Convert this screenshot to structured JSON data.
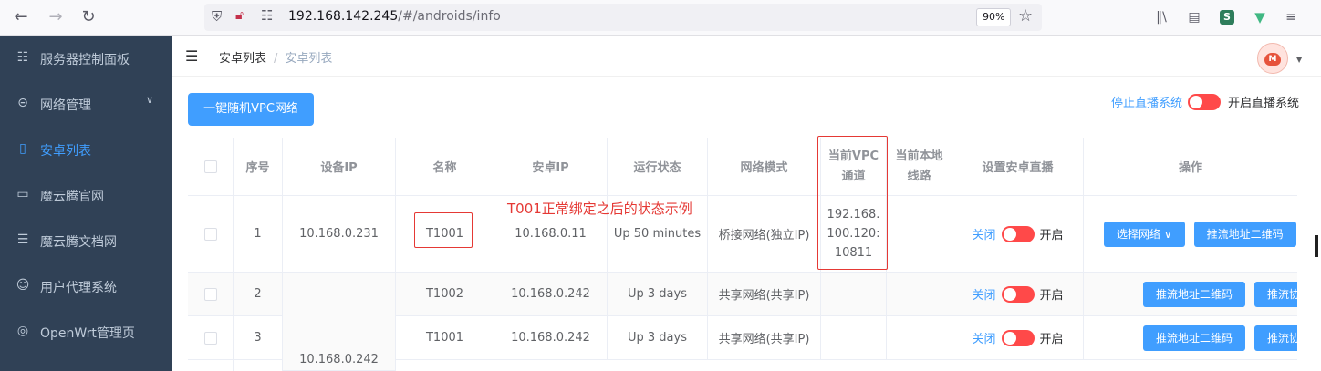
{
  "browser": {
    "url_host": "192.168.142.245",
    "url_path": "/#/androids/info",
    "zoom": "90%"
  },
  "sidebar": {
    "items": [
      {
        "label": "服务器控制面板",
        "icon": "sitemap-icon"
      },
      {
        "label": "网络管理",
        "icon": "network-icon"
      },
      {
        "label": "安卓列表",
        "icon": "phone-icon",
        "active": true
      },
      {
        "label": "魔云腾官网",
        "icon": "monitor-icon"
      },
      {
        "label": "魔云腾文档网",
        "icon": "document-icon"
      },
      {
        "label": "用户代理系统",
        "icon": "user-icon"
      },
      {
        "label": "OpenWrt管理页",
        "icon": "wifi-router-icon"
      }
    ]
  },
  "breadcrumb": {
    "first": "安卓列表",
    "sep": "/",
    "second": "安卓列表"
  },
  "toolbar": {
    "random_vpc_button": "一键随机VPC网络",
    "stop_live": "停止直播系统",
    "start_live": "开启直播系统"
  },
  "table": {
    "headers": [
      "序号",
      "设备IP",
      "名称",
      "安卓IP",
      "运行状态",
      "网络模式",
      "当前VPC\n通道",
      "当前本地\n线路",
      "设置安卓直播",
      "操作"
    ],
    "rows": [
      {
        "index": "1",
        "device_ip": "10.168.0.231",
        "name": "T1001",
        "android_ip": "10.168.0.11",
        "status": "Up 50 minutes",
        "network_mode": "桥接网络(独立IP)",
        "vpc_channel": "192.168.\n100.120:\n10811",
        "local_line": "",
        "live_off": "关闭",
        "live_on": "开启",
        "actions": [
          "选择网络",
          "推流地址二维码"
        ]
      },
      {
        "index": "2",
        "device_ip": "",
        "name": "T1002",
        "android_ip": "10.168.0.242",
        "status": "Up 3 days",
        "network_mode": "共享网络(共享IP)",
        "vpc_channel": "",
        "local_line": "",
        "live_off": "关闭",
        "live_on": "开启",
        "actions": [
          "推流地址二维码",
          "推流协议"
        ]
      },
      {
        "index": "3",
        "device_ip": "10.168.0.242",
        "name": "T1001",
        "android_ip": "10.168.0.242",
        "status": "Up 3 days",
        "network_mode": "共享网络(共享IP)",
        "vpc_channel": "",
        "local_line": "",
        "live_off": "关闭",
        "live_on": "开启",
        "actions": [
          "推流地址二维码",
          "推流协议"
        ]
      }
    ]
  },
  "annotation": "T001正常绑定之后的状态示例",
  "colors": {
    "primary": "#409eff",
    "sidebar_bg": "#304156",
    "switch_off": "#ff4949",
    "annotation": "#e53935"
  }
}
